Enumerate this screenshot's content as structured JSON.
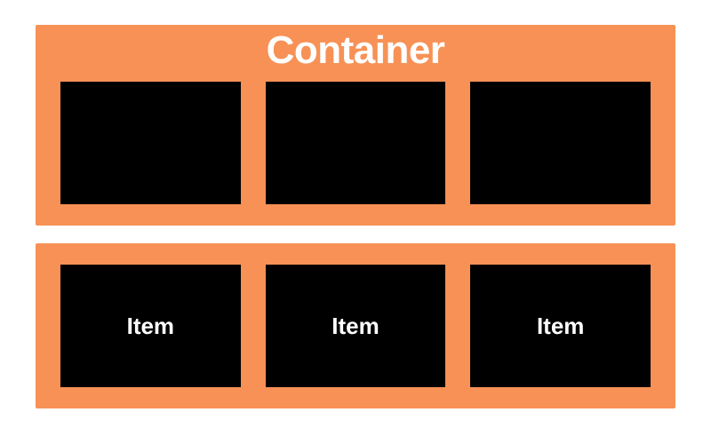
{
  "colors": {
    "container_bg": "#f79155",
    "item_bg": "#000000",
    "text": "#ffffff",
    "page_bg": "#ffffff"
  },
  "top_container": {
    "title": "Container",
    "items": [
      {
        "label": ""
      },
      {
        "label": ""
      },
      {
        "label": ""
      }
    ]
  },
  "bottom_container": {
    "items": [
      {
        "label": "Item"
      },
      {
        "label": "Item"
      },
      {
        "label": "Item"
      }
    ]
  }
}
